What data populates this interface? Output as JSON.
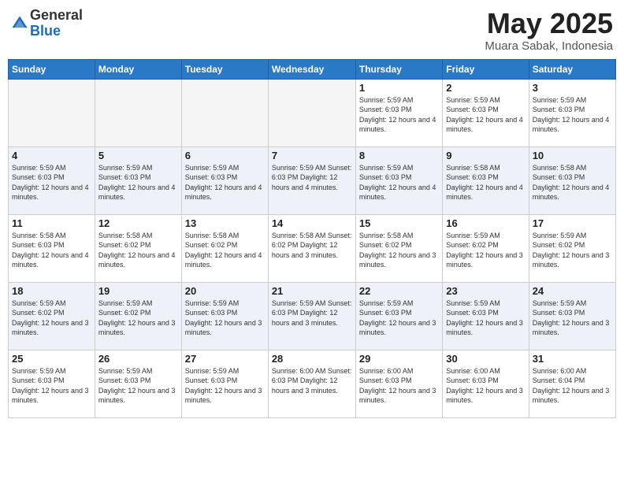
{
  "header": {
    "logo_general": "General",
    "logo_blue": "Blue",
    "month_title": "May 2025",
    "location": "Muara Sabak, Indonesia"
  },
  "weekdays": [
    "Sunday",
    "Monday",
    "Tuesday",
    "Wednesday",
    "Thursday",
    "Friday",
    "Saturday"
  ],
  "weeks": [
    [
      {
        "day": "",
        "info": ""
      },
      {
        "day": "",
        "info": ""
      },
      {
        "day": "",
        "info": ""
      },
      {
        "day": "",
        "info": ""
      },
      {
        "day": "1",
        "info": "Sunrise: 5:59 AM\nSunset: 6:03 PM\nDaylight: 12 hours\nand 4 minutes."
      },
      {
        "day": "2",
        "info": "Sunrise: 5:59 AM\nSunset: 6:03 PM\nDaylight: 12 hours\nand 4 minutes."
      },
      {
        "day": "3",
        "info": "Sunrise: 5:59 AM\nSunset: 6:03 PM\nDaylight: 12 hours\nand 4 minutes."
      }
    ],
    [
      {
        "day": "4",
        "info": "Sunrise: 5:59 AM\nSunset: 6:03 PM\nDaylight: 12 hours\nand 4 minutes."
      },
      {
        "day": "5",
        "info": "Sunrise: 5:59 AM\nSunset: 6:03 PM\nDaylight: 12 hours\nand 4 minutes."
      },
      {
        "day": "6",
        "info": "Sunrise: 5:59 AM\nSunset: 6:03 PM\nDaylight: 12 hours\nand 4 minutes."
      },
      {
        "day": "7",
        "info": "Sunrise: 5:59 AM\nSunset: 6:03 PM\nDaylight: 12 hours\nand 4 minutes."
      },
      {
        "day": "8",
        "info": "Sunrise: 5:59 AM\nSunset: 6:03 PM\nDaylight: 12 hours\nand 4 minutes."
      },
      {
        "day": "9",
        "info": "Sunrise: 5:58 AM\nSunset: 6:03 PM\nDaylight: 12 hours\nand 4 minutes."
      },
      {
        "day": "10",
        "info": "Sunrise: 5:58 AM\nSunset: 6:03 PM\nDaylight: 12 hours\nand 4 minutes."
      }
    ],
    [
      {
        "day": "11",
        "info": "Sunrise: 5:58 AM\nSunset: 6:03 PM\nDaylight: 12 hours\nand 4 minutes."
      },
      {
        "day": "12",
        "info": "Sunrise: 5:58 AM\nSunset: 6:02 PM\nDaylight: 12 hours\nand 4 minutes."
      },
      {
        "day": "13",
        "info": "Sunrise: 5:58 AM\nSunset: 6:02 PM\nDaylight: 12 hours\nand 4 minutes."
      },
      {
        "day": "14",
        "info": "Sunrise: 5:58 AM\nSunset: 6:02 PM\nDaylight: 12 hours\nand 3 minutes."
      },
      {
        "day": "15",
        "info": "Sunrise: 5:58 AM\nSunset: 6:02 PM\nDaylight: 12 hours\nand 3 minutes."
      },
      {
        "day": "16",
        "info": "Sunrise: 5:59 AM\nSunset: 6:02 PM\nDaylight: 12 hours\nand 3 minutes."
      },
      {
        "day": "17",
        "info": "Sunrise: 5:59 AM\nSunset: 6:02 PM\nDaylight: 12 hours\nand 3 minutes."
      }
    ],
    [
      {
        "day": "18",
        "info": "Sunrise: 5:59 AM\nSunset: 6:02 PM\nDaylight: 12 hours\nand 3 minutes."
      },
      {
        "day": "19",
        "info": "Sunrise: 5:59 AM\nSunset: 6:02 PM\nDaylight: 12 hours\nand 3 minutes."
      },
      {
        "day": "20",
        "info": "Sunrise: 5:59 AM\nSunset: 6:03 PM\nDaylight: 12 hours\nand 3 minutes."
      },
      {
        "day": "21",
        "info": "Sunrise: 5:59 AM\nSunset: 6:03 PM\nDaylight: 12 hours\nand 3 minutes."
      },
      {
        "day": "22",
        "info": "Sunrise: 5:59 AM\nSunset: 6:03 PM\nDaylight: 12 hours\nand 3 minutes."
      },
      {
        "day": "23",
        "info": "Sunrise: 5:59 AM\nSunset: 6:03 PM\nDaylight: 12 hours\nand 3 minutes."
      },
      {
        "day": "24",
        "info": "Sunrise: 5:59 AM\nSunset: 6:03 PM\nDaylight: 12 hours\nand 3 minutes."
      }
    ],
    [
      {
        "day": "25",
        "info": "Sunrise: 5:59 AM\nSunset: 6:03 PM\nDaylight: 12 hours\nand 3 minutes."
      },
      {
        "day": "26",
        "info": "Sunrise: 5:59 AM\nSunset: 6:03 PM\nDaylight: 12 hours\nand 3 minutes."
      },
      {
        "day": "27",
        "info": "Sunrise: 5:59 AM\nSunset: 6:03 PM\nDaylight: 12 hours\nand 3 minutes."
      },
      {
        "day": "28",
        "info": "Sunrise: 6:00 AM\nSunset: 6:03 PM\nDaylight: 12 hours\nand 3 minutes."
      },
      {
        "day": "29",
        "info": "Sunrise: 6:00 AM\nSunset: 6:03 PM\nDaylight: 12 hours\nand 3 minutes."
      },
      {
        "day": "30",
        "info": "Sunrise: 6:00 AM\nSunset: 6:03 PM\nDaylight: 12 hours\nand 3 minutes."
      },
      {
        "day": "31",
        "info": "Sunrise: 6:00 AM\nSunset: 6:04 PM\nDaylight: 12 hours\nand 3 minutes."
      }
    ]
  ]
}
